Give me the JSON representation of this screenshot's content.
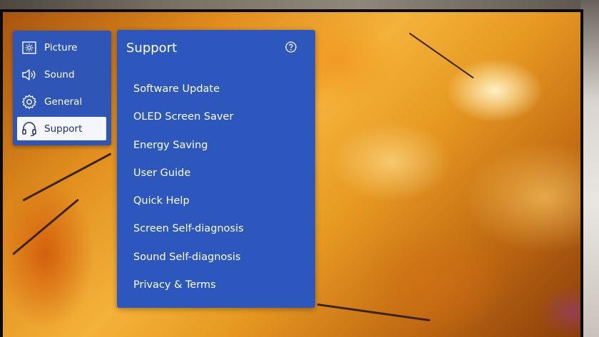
{
  "nav": {
    "items": [
      {
        "label": "Picture",
        "icon": "picture-icon",
        "active": false
      },
      {
        "label": "Sound",
        "icon": "speaker-icon",
        "active": false
      },
      {
        "label": "General",
        "icon": "gear-icon",
        "active": false
      },
      {
        "label": "Support",
        "icon": "headset-icon",
        "active": true
      }
    ]
  },
  "support": {
    "title": "Support",
    "help_icon": "question-circle-icon",
    "items": [
      "Software Update",
      "OLED Screen Saver",
      "Energy Saving",
      "User Guide",
      "Quick Help",
      "Screen Self-diagnosis",
      "Sound Self-diagnosis",
      "Privacy & Terms"
    ]
  },
  "colors": {
    "panel_blue": "#2e57be",
    "active_bg": "#f4f6fb",
    "text": "#ffffff"
  }
}
